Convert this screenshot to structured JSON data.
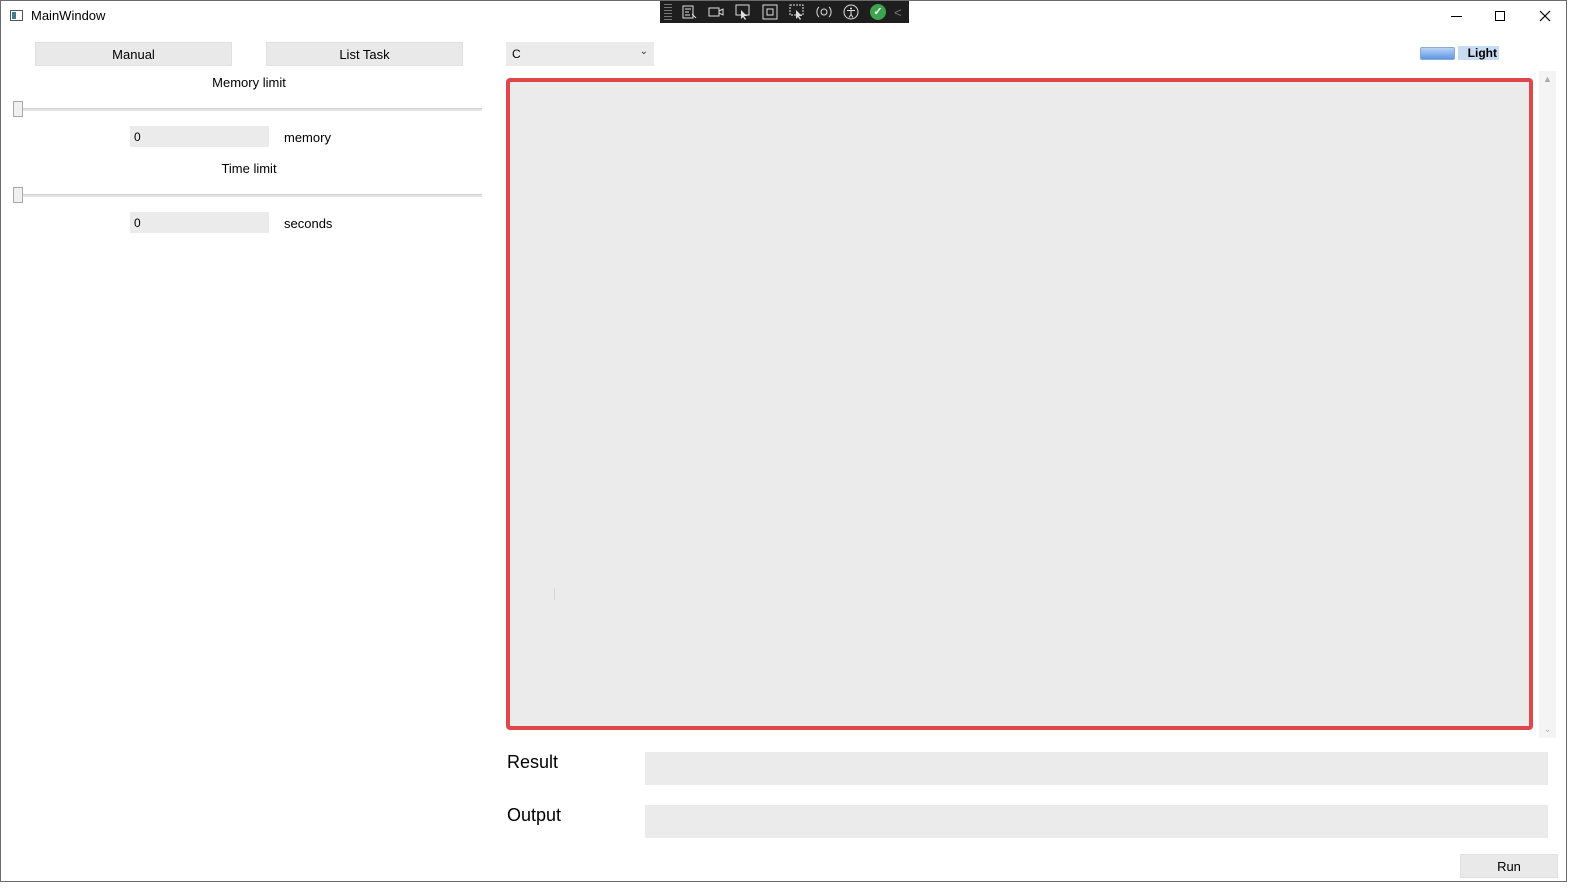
{
  "window": {
    "title": "MainWindow",
    "controls": [
      "minimize-icon",
      "maximize-icon",
      "close-icon"
    ]
  },
  "debug_toolbar": {
    "icons": [
      "live-visual-tree-icon",
      "record-icon",
      "select-element-icon",
      "display-layout-adorners-icon",
      "track-focus-icon",
      "hot-reload-icon",
      "accessibility-icon",
      "binding-check-icon",
      "collapse-toolbar-icon"
    ]
  },
  "left_panel": {
    "manual_label": "Manual",
    "list_task_label": "List Task",
    "memory": {
      "title": "Memory limit",
      "value": "0",
      "unit": "memory",
      "slider_fraction": 0
    },
    "time": {
      "title": "Time limit",
      "value": "0",
      "unit": "seconds",
      "slider_fraction": 0
    }
  },
  "language_select": {
    "selected": "C"
  },
  "theme_toggle": {
    "label": "Light"
  },
  "editor": {
    "content": ""
  },
  "result": {
    "label": "Result",
    "value": ""
  },
  "output": {
    "label": "Output",
    "value": ""
  },
  "run_label": "Run",
  "colors": {
    "editor_border": "#e0464b",
    "field_bg": "#ebebeb",
    "toolbar_bg": "#1e1e1e",
    "toggle_accent": "#5f97e4"
  }
}
